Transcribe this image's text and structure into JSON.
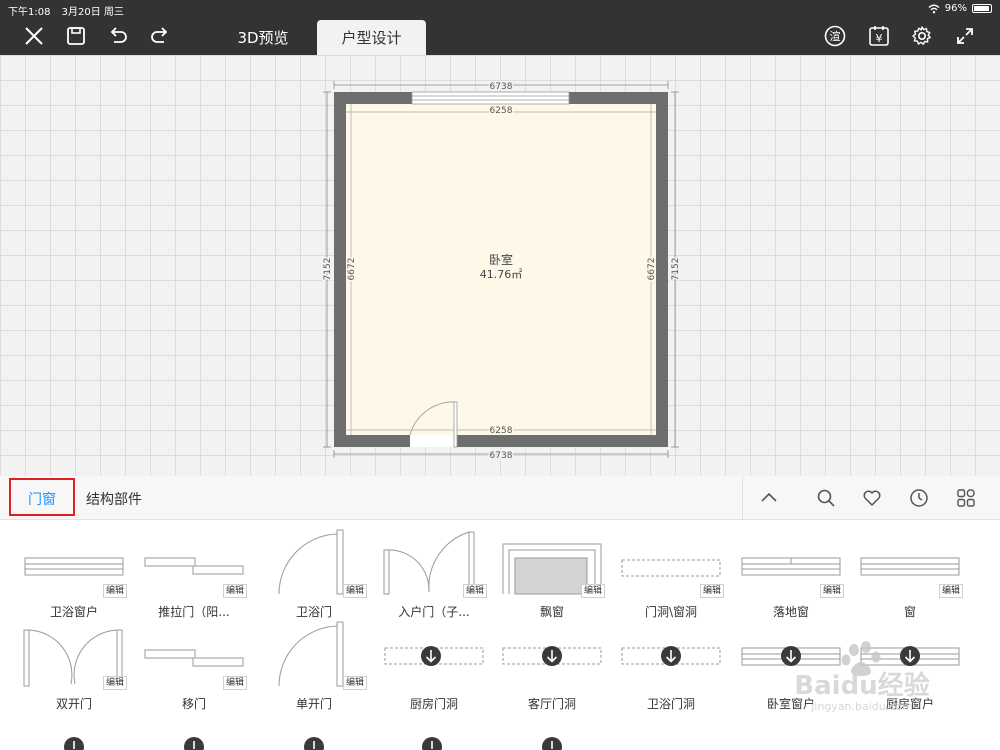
{
  "status": {
    "time": "下午1:08",
    "date": "3月20日 周三",
    "battery": "96%"
  },
  "toolbar": {
    "tabs": [
      {
        "label": "3D预览"
      },
      {
        "label": "户型设计"
      }
    ],
    "render_badge": "渲",
    "quote_badge": "¥"
  },
  "plan": {
    "room_name": "卧室",
    "room_area": "41.76㎡",
    "outer_width": "6738",
    "inner_width": "6258",
    "outer_height": "7152",
    "inner_height": "6672"
  },
  "panel": {
    "categories": [
      {
        "label": "门窗"
      },
      {
        "label": "结构部件"
      }
    ],
    "edit_badge": "编辑",
    "items": [
      {
        "label": "卫浴窗户"
      },
      {
        "label": "推拉门（阳..."
      },
      {
        "label": "卫浴门"
      },
      {
        "label": "入户门（子..."
      },
      {
        "label": "飘窗"
      },
      {
        "label": "门洞\\窗洞"
      },
      {
        "label": "落地窗"
      },
      {
        "label": "窗"
      },
      {
        "label": "双开门"
      },
      {
        "label": "移门"
      },
      {
        "label": "单开门"
      },
      {
        "label": "厨房门洞"
      },
      {
        "label": "客厅门洞"
      },
      {
        "label": "卫浴门洞"
      },
      {
        "label": "卧室窗户"
      },
      {
        "label": "厨房窗户"
      }
    ]
  },
  "watermark": {
    "brand": "Baidu经验",
    "url": "jingyan.baidu.com"
  },
  "colors": {
    "accent": "#1e90ff",
    "highlight": "#e02020",
    "wall": "#6e6e6e",
    "floor": "#fdf8e8",
    "toolbar": "#333333"
  }
}
